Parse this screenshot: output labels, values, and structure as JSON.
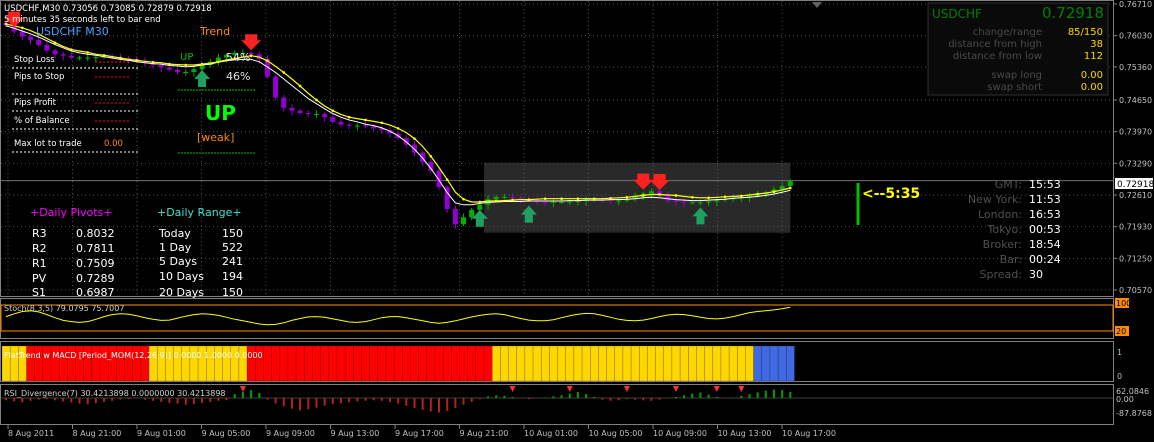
{
  "header": {
    "symbol_line": "USDCHF,M30  0.73056 0.73085 0.72879 0.72918",
    "bar_timer": "5 minutes 35 seconds left to bar end"
  },
  "panel_trend": {
    "pair_tf": "USDCHF  M30",
    "trend_title": "Trend",
    "up_label": "UP",
    "up_pct": "54%",
    "down_pct": "46%",
    "big_signal": "UP",
    "strength": "[weak]"
  },
  "panel_risk": {
    "rows": [
      "Stop Loss",
      "Pips to Stop",
      "Pips Profit",
      "% of Balance",
      "Max lot to trade"
    ],
    "max_lot_value": "0.00"
  },
  "panel_pivots": {
    "title": "+Daily Pivots+",
    "rows": [
      {
        "label": "R3",
        "value": "0.8032"
      },
      {
        "label": "R2",
        "value": "0.7811"
      },
      {
        "label": "R1",
        "value": "0.7509"
      },
      {
        "label": "PV",
        "value": "0.7289"
      },
      {
        "label": "S1",
        "value": "0.6987"
      }
    ]
  },
  "panel_range": {
    "title": "+Daily Range+",
    "rows": [
      {
        "label": "Today",
        "value": "150"
      },
      {
        "label": "1 Day",
        "value": "522"
      },
      {
        "label": "5 Days",
        "value": "241"
      },
      {
        "label": "10 Days",
        "value": "194"
      },
      {
        "label": "20 Days",
        "value": "150"
      }
    ]
  },
  "panel_info": {
    "symbol": "USDCHF",
    "price": "0.72918",
    "rows": [
      {
        "label": "change/range",
        "value": "85/150"
      },
      {
        "label": "distance from high",
        "value": "38"
      },
      {
        "label": "distance from low",
        "value": "112"
      },
      {
        "label": "swap long",
        "value": "0.00"
      },
      {
        "label": "swap short",
        "value": "0.00"
      }
    ]
  },
  "panel_clock": {
    "rows": [
      {
        "label": "GMT:",
        "value": "15:53"
      },
      {
        "label": "New York:",
        "value": "11:53"
      },
      {
        "label": "London:",
        "value": "16:53"
      },
      {
        "label": "Tokyo:",
        "value": "00:53"
      },
      {
        "label": "Broker:",
        "value": "18:54"
      },
      {
        "label": "Bar:",
        "value": "00:24"
      },
      {
        "label": "Spread:",
        "value": "30"
      }
    ],
    "countdown": "<--5:35"
  },
  "colors": {
    "bull": "#00b000",
    "bear": "#9400d3",
    "ma_fast": "#ffff00",
    "ma_slow": "#ffffff",
    "grid": "#505050",
    "price_line": "#707070",
    "stoch_level": "#ff8c00",
    "macd_up": "#ffd700",
    "macd_down": "#ff0000",
    "macd_flat": "#4169e1",
    "hist_up": "#00a000",
    "hist_down": "#b22222"
  },
  "chart_data": [
    {
      "type": "candlestick",
      "title": "USDCHF,M30",
      "y_ticks": [
        "0.76710",
        "0.76030",
        "0.75360",
        "0.74650",
        "0.73970",
        "0.73290",
        "0.72610",
        "0.71930",
        "0.71250",
        "0.70570"
      ],
      "ylim": [
        0.7057,
        0.7671
      ],
      "current_price": "0.72918",
      "x_ticks": [
        "8 Aug 2011",
        "8 Aug 21:00",
        "9 Aug 01:00",
        "9 Aug 05:00",
        "9 Aug 09:00",
        "9 Aug 13:00",
        "9 Aug 17:00",
        "9 Aug 21:00",
        "10 Aug 01:00",
        "10 Aug 05:00",
        "10 Aug 09:00",
        "10 Aug 13:00",
        "10 Aug 17:00"
      ],
      "close": [
        0.7625,
        0.7612,
        0.7601,
        0.7594,
        0.7583,
        0.7571,
        0.7563,
        0.756,
        0.7556,
        0.7556,
        0.7556,
        0.7557,
        0.7558,
        0.7557,
        0.7555,
        0.7553,
        0.7548,
        0.7544,
        0.754,
        0.7535,
        0.753,
        0.7525,
        0.7525,
        0.7531,
        0.754,
        0.7547,
        0.7556,
        0.7562,
        0.7566,
        0.7566,
        0.7563,
        0.7553,
        0.7515,
        0.747,
        0.7448,
        0.7442,
        0.7437,
        0.7435,
        0.7435,
        0.7428,
        0.7418,
        0.7412,
        0.741,
        0.741,
        0.7408,
        0.7404,
        0.74,
        0.7393,
        0.7383,
        0.7369,
        0.7352,
        0.7332,
        0.7313,
        0.7278,
        0.7231,
        0.7198,
        0.7213,
        0.7229,
        0.724,
        0.7252,
        0.7257,
        0.7257,
        0.7255,
        0.7252,
        0.7249,
        0.7246,
        0.7245,
        0.7246,
        0.7246,
        0.7247,
        0.7248,
        0.725,
        0.7251,
        0.725,
        0.7249,
        0.7249,
        0.7253,
        0.7258,
        0.7264,
        0.7269,
        0.7263,
        0.7249,
        0.7246,
        0.7245,
        0.7245,
        0.7245,
        0.7247,
        0.725,
        0.7252,
        0.7254,
        0.7256,
        0.7259,
        0.7262,
        0.7267,
        0.7273,
        0.728,
        0.7291
      ],
      "ma_fast": [
        0.7628,
        0.7624,
        0.762,
        0.7614,
        0.7606,
        0.7597,
        0.7588,
        0.758,
        0.7573,
        0.757,
        0.7567,
        0.7563,
        0.7561,
        0.7558,
        0.7555,
        0.7552,
        0.755,
        0.7548,
        0.7546,
        0.7545,
        0.7542,
        0.7541,
        0.754,
        0.754,
        0.7542,
        0.7544,
        0.7547,
        0.7551,
        0.7554,
        0.7557,
        0.756,
        0.7557,
        0.7549,
        0.7537,
        0.7524,
        0.751,
        0.7495,
        0.7479,
        0.7465,
        0.7452,
        0.7442,
        0.7434,
        0.7428,
        0.7425,
        0.7422,
        0.7419,
        0.7416,
        0.7411,
        0.7404,
        0.7395,
        0.7382,
        0.7365,
        0.7344,
        0.732,
        0.7294,
        0.7267,
        0.7252,
        0.7246,
        0.7246,
        0.7248,
        0.7248,
        0.7249,
        0.725,
        0.7251,
        0.7251,
        0.7252,
        0.7253,
        0.7253,
        0.7253,
        0.7253,
        0.7253,
        0.7253,
        0.7253,
        0.7253,
        0.7254,
        0.7255,
        0.7256,
        0.7258,
        0.726,
        0.7262,
        0.7262,
        0.7261,
        0.726,
        0.7258,
        0.7256,
        0.7255,
        0.7255,
        0.7256,
        0.7257,
        0.7258,
        0.7259,
        0.7261,
        0.7263,
        0.7265,
        0.7268,
        0.7272,
        0.7276
      ],
      "ma_slow": [
        0.7624,
        0.7619,
        0.7613,
        0.7607,
        0.76,
        0.7592,
        0.7584,
        0.7577,
        0.757,
        0.7566,
        0.7563,
        0.7561,
        0.7558,
        0.7555,
        0.7552,
        0.755,
        0.7547,
        0.7545,
        0.7543,
        0.7542,
        0.7539,
        0.7538,
        0.7536,
        0.7537,
        0.754,
        0.7542,
        0.7546,
        0.7549,
        0.7551,
        0.7552,
        0.7552,
        0.7547,
        0.7536,
        0.7524,
        0.751,
        0.7496,
        0.7482,
        0.7468,
        0.7457,
        0.7446,
        0.7436,
        0.7428,
        0.7422,
        0.7418,
        0.7413,
        0.741,
        0.7405,
        0.7398,
        0.7388,
        0.7375,
        0.7359,
        0.734,
        0.7318,
        0.7293,
        0.7266,
        0.7244,
        0.724,
        0.724,
        0.7243,
        0.7245,
        0.7246,
        0.7247,
        0.7247,
        0.7247,
        0.7248,
        0.7248,
        0.7248,
        0.7248,
        0.7248,
        0.7249,
        0.7249,
        0.725,
        0.725,
        0.725,
        0.7251,
        0.7251,
        0.7252,
        0.7253,
        0.7255,
        0.7256,
        0.7255,
        0.7253,
        0.7251,
        0.725,
        0.7249,
        0.7249,
        0.725,
        0.7251,
        0.7252,
        0.7254,
        0.7255,
        0.7256,
        0.7258,
        0.726,
        0.7263,
        0.7267,
        0.7271
      ],
      "signals": [
        {
          "index": 1,
          "direction": "down"
        },
        {
          "index": 24,
          "direction": "up"
        },
        {
          "index": 30,
          "direction": "down"
        },
        {
          "index": 58,
          "direction": "up"
        },
        {
          "index": 64,
          "direction": "up"
        },
        {
          "index": 78,
          "direction": "down"
        },
        {
          "index": 80,
          "direction": "down"
        },
        {
          "index": 85,
          "direction": "up"
        }
      ],
      "consolidation_box": {
        "start_index": 59,
        "end_index": 96,
        "high": 0.733,
        "low": 0.718
      }
    },
    {
      "type": "line",
      "title": "Stoch(8,3,5) 79.0795 75.7007",
      "levels": [
        "100",
        "80",
        "20",
        "0"
      ],
      "values": [
        0.55,
        0.62,
        0.68,
        0.7,
        0.67,
        0.6,
        0.52,
        0.45,
        0.42,
        0.4,
        0.42,
        0.48,
        0.55,
        0.6,
        0.62,
        0.61,
        0.57,
        0.52,
        0.48,
        0.45,
        0.46,
        0.51,
        0.56,
        0.6,
        0.62,
        0.61,
        0.58,
        0.53,
        0.48,
        0.44,
        0.4,
        0.36,
        0.34,
        0.35,
        0.39,
        0.45,
        0.5,
        0.54,
        0.55,
        0.53,
        0.49,
        0.45,
        0.41,
        0.4,
        0.42,
        0.47,
        0.52,
        0.55,
        0.55,
        0.52,
        0.48,
        0.44,
        0.4,
        0.38,
        0.4,
        0.44,
        0.49,
        0.54,
        0.58,
        0.61,
        0.62,
        0.6,
        0.55,
        0.5,
        0.46,
        0.44,
        0.44,
        0.47,
        0.52,
        0.57,
        0.61,
        0.63,
        0.62,
        0.58,
        0.53,
        0.48,
        0.45,
        0.44,
        0.46,
        0.5,
        0.55,
        0.59,
        0.61,
        0.6,
        0.57,
        0.53,
        0.5,
        0.49,
        0.51,
        0.55,
        0.6,
        0.65,
        0.68,
        0.7,
        0.72,
        0.75,
        0.79
      ]
    },
    {
      "type": "bar",
      "title": "FlatTrend w MACD [Period_MOM(12,26,9)] 0.0000 1.0000 0.0000",
      "y_ticks": [
        "1",
        "0"
      ],
      "segments": [
        {
          "state": "up",
          "count": 3
        },
        {
          "state": "down",
          "count": 15
        },
        {
          "state": "up",
          "count": 12
        },
        {
          "state": "down",
          "count": 30
        },
        {
          "state": "up",
          "count": 32
        },
        {
          "state": "flat",
          "count": 5
        }
      ]
    },
    {
      "type": "bar",
      "title": "RSI_Divergence(7) 30.4213898 0.0000000 30.4213898",
      "y_ticks": [
        "62.0846",
        "0.00",
        "-87.8768"
      ],
      "values": [
        -8,
        -12,
        -15,
        -10,
        -6,
        -4,
        -8,
        -12,
        -16,
        -20,
        -22,
        -18,
        -14,
        -10,
        -6,
        -4,
        -2,
        -6,
        -10,
        -14,
        -18,
        -20,
        -24,
        -22,
        -18,
        -14,
        -10,
        -8,
        14,
        22,
        28,
        18,
        -6,
        -20,
        -30,
        -38,
        -44,
        -40,
        -34,
        -28,
        -22,
        -18,
        -15,
        -12,
        -10,
        -8,
        -10,
        -14,
        -20,
        -28,
        -36,
        -42,
        -48,
        -52,
        -46,
        -36,
        -24,
        -14,
        -4,
        6,
        10,
        8,
        4,
        -2,
        -4,
        -2,
        2,
        6,
        10,
        16,
        22,
        14,
        4,
        -6,
        -10,
        -8,
        -4,
        -6,
        -8,
        -10,
        -6,
        -2,
        4,
        10,
        16,
        20,
        12,
        4,
        -2,
        2,
        8,
        14,
        20,
        26,
        30,
        28,
        22
      ],
      "markers": [
        29,
        62,
        69,
        76,
        82,
        87,
        90
      ]
    }
  ]
}
